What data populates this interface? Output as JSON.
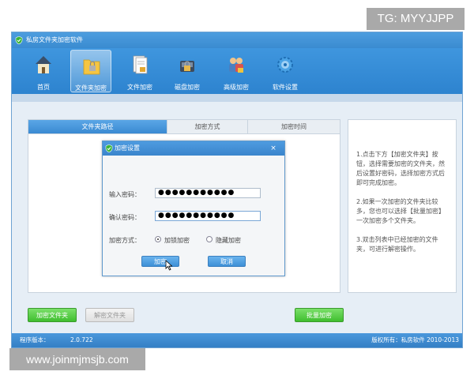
{
  "overlays": {
    "tg": "TG: MYYJJPP",
    "url": "www.joinmjmsjb.com"
  },
  "window": {
    "title": "私房文件夹加密软件"
  },
  "toolbar": {
    "items": [
      {
        "label": "首页",
        "icon": "home-icon"
      },
      {
        "label": "文件夹加密",
        "icon": "folder-lock-icon",
        "active": true
      },
      {
        "label": "文件加密",
        "icon": "file-lock-icon"
      },
      {
        "label": "磁盘加密",
        "icon": "disk-lock-icon"
      },
      {
        "label": "高级加密",
        "icon": "advanced-lock-icon"
      },
      {
        "label": "软件设置",
        "icon": "gear-icon"
      }
    ]
  },
  "tabs": [
    {
      "label": "文件夹路径",
      "active": true
    },
    {
      "label": "加密方式"
    },
    {
      "label": "加密时间"
    }
  ],
  "help": {
    "p1": "1.点击下方【加密文件夹】按钮，选择需要加密的文件夹，然后设置好密码，选择加密方式后即可完成加密。",
    "p2": "2.如果一次加密的文件夹比较多，您也可以选择【批量加密】一次加密多个文件夹。",
    "p3": "3.双击列表中已经加密的文件夹，可进行解密操作。"
  },
  "dialog": {
    "title": "加密设置",
    "close": "×",
    "password_label": "输入密码：",
    "password_value": "●●●●●●●●●●●",
    "confirm_label": "确认密码：",
    "confirm_value": "●●●●●●●●●●●",
    "method_label": "加密方式：",
    "option1": "加锁加密",
    "option2": "隐藏加密",
    "ok": "加密",
    "cancel": "取消"
  },
  "buttons": {
    "encrypt_folder": "加密文件夹",
    "decrypt_folder": "解密文件夹",
    "batch_encrypt": "批量加密"
  },
  "status": {
    "version_label": "程序版本：",
    "version": "2.0.722",
    "copyright": "版权所有：私房软件  2010-2013"
  },
  "colors": {
    "toolbar": "#3a8bd0",
    "accent_green": "#3fbe2f",
    "dialog_border": "#5e98cc"
  }
}
